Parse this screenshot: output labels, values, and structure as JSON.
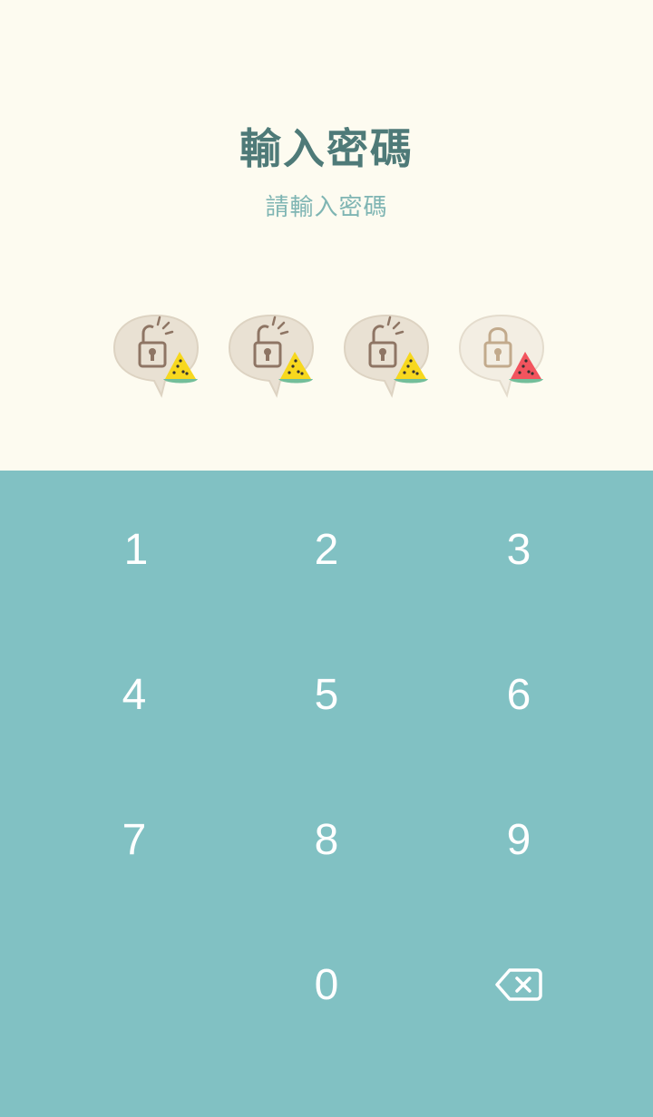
{
  "header": {
    "title": "輸入密碼",
    "subtitle": "請輸入密碼"
  },
  "passcode": {
    "slots": [
      {
        "state": "unlocked",
        "fruit": "yellow-watermelon"
      },
      {
        "state": "unlocked",
        "fruit": "yellow-watermelon"
      },
      {
        "state": "unlocked",
        "fruit": "yellow-watermelon"
      },
      {
        "state": "locked",
        "fruit": "red-watermelon"
      }
    ]
  },
  "keypad": {
    "keys": [
      "1",
      "2",
      "3",
      "4",
      "5",
      "6",
      "7",
      "8",
      "9",
      "0"
    ],
    "delete_icon": "backspace-icon"
  },
  "colors": {
    "top_background": "#FDFBF0",
    "keypad_background": "#81C1C3",
    "title": "#4E7A78",
    "subtitle": "#7FB5B3",
    "key_text": "#FFFFFF"
  }
}
